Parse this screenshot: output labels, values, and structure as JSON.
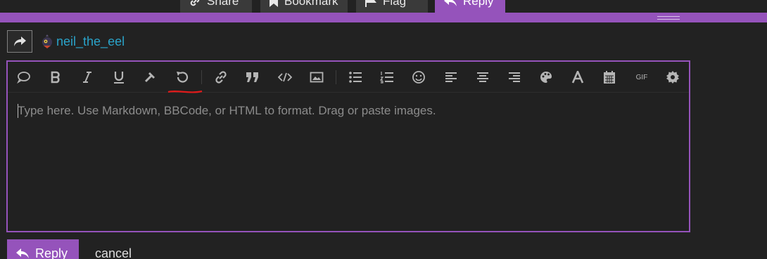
{
  "post_actions": {
    "share": "Share",
    "bookmark": "Bookmark",
    "flag": "Flag",
    "reply": "Reply"
  },
  "reply_to": {
    "username": "neil_the_eel",
    "type_icon": "share-arrow-icon",
    "avatar_icon": "user-avatar"
  },
  "toolbar": {
    "buttons": [
      {
        "name": "quote-icon"
      },
      {
        "name": "bold-icon"
      },
      {
        "name": "italic-icon"
      },
      {
        "name": "underline-icon"
      },
      {
        "name": "hammer-icon"
      },
      {
        "name": "undo-icon"
      },
      {
        "name": "link-icon"
      },
      {
        "name": "blockquote-icon"
      },
      {
        "name": "code-icon"
      },
      {
        "name": "image-icon"
      },
      {
        "name": "bullet-list-icon"
      },
      {
        "name": "numbered-list-icon"
      },
      {
        "name": "emoji-icon"
      },
      {
        "name": "align-left-icon"
      },
      {
        "name": "align-center-icon"
      },
      {
        "name": "align-right-icon"
      },
      {
        "name": "palette-icon"
      },
      {
        "name": "font-icon"
      },
      {
        "name": "calendar-icon"
      },
      {
        "name": "gif-icon",
        "label": "GIF"
      },
      {
        "name": "gear-icon"
      }
    ]
  },
  "editor": {
    "placeholder": "Type here. Use Markdown, BBCode, or HTML to format. Drag or paste images."
  },
  "actions": {
    "submit": "Reply",
    "cancel": "cancel"
  },
  "colors": {
    "accent": "#9553bb",
    "background": "#222222",
    "username": "#2aa3c9",
    "annotation": "#e01b1b"
  }
}
